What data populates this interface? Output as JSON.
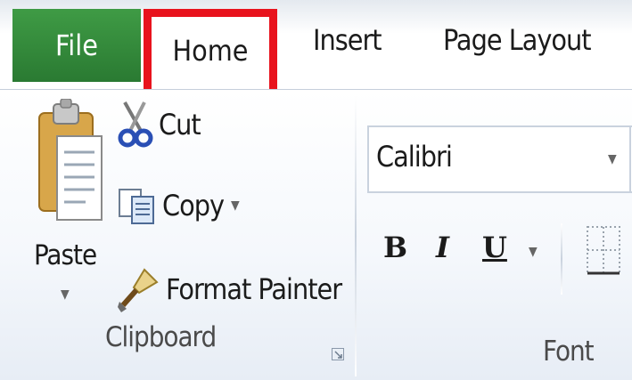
{
  "tabs": {
    "file": "File",
    "home": "Home",
    "insert": "Insert",
    "page_layout": "Page Layout"
  },
  "highlight_color": "#e8131d",
  "file_tab_color": "#2f8a38",
  "clipboard": {
    "paste": "Paste",
    "cut": "Cut",
    "copy": "Copy",
    "format_painter": "Format Painter",
    "group_label": "Clipboard"
  },
  "font": {
    "font_name": "Calibri",
    "bold": "B",
    "italic": "I",
    "underline": "U",
    "group_label": "Font"
  },
  "icons": [
    "clipboard-paste-icon",
    "scissors-icon",
    "copy-icon",
    "format-painter-brush-icon",
    "borders-icon",
    "dialog-launcher-icon"
  ]
}
